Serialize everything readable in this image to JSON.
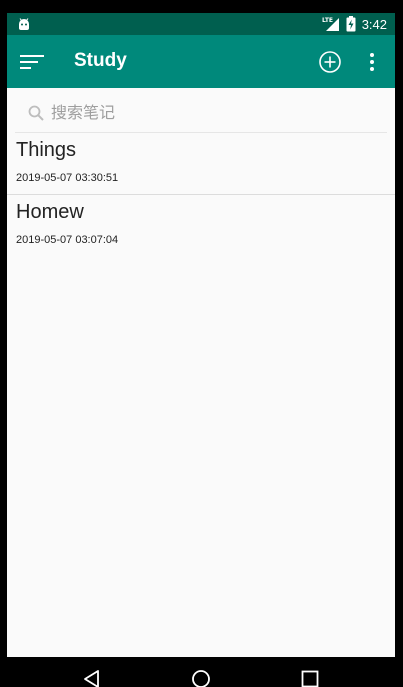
{
  "status_bar": {
    "time": "3:42",
    "network_label": "LTE",
    "icons": [
      "android-debug-icon",
      "lte-signal-icon",
      "battery-charging-icon"
    ]
  },
  "app_bar": {
    "title": "Study",
    "icons": [
      "menu-sort-icon",
      "add-circle-icon",
      "more-vert-icon"
    ],
    "background": "#00897b",
    "status_background": "#005f4f"
  },
  "search": {
    "placeholder": "搜索笔记",
    "icon": "search-icon"
  },
  "notes": [
    {
      "title": "Things",
      "time": "2019-05-07 03:30:51"
    },
    {
      "title": "Homew",
      "time": "2019-05-07 03:07:04"
    }
  ],
  "nav_bar": {
    "icons": [
      "back-icon",
      "home-icon",
      "recents-icon"
    ]
  }
}
